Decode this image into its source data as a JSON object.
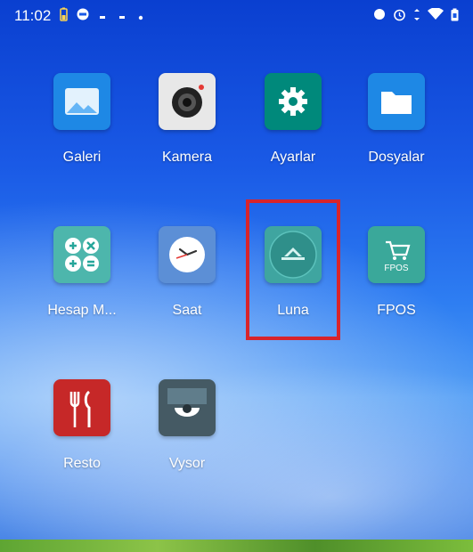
{
  "status_bar": {
    "time": "11:02",
    "left_icons": [
      "battery-icon",
      "notification-icon",
      "dot-icon",
      "dot-icon",
      "dot-icon"
    ],
    "right_icons": [
      "circle-icon",
      "alarm-icon",
      "data-arrows-icon",
      "wifi-icon",
      "battery-icon"
    ]
  },
  "apps": [
    {
      "label": "Galeri",
      "icon": "gallery-icon",
      "color": "#1e88e5"
    },
    {
      "label": "Kamera",
      "icon": "camera-icon",
      "color": "#e8e8e8"
    },
    {
      "label": "Ayarlar",
      "icon": "settings-gear-icon",
      "color": "#00897b"
    },
    {
      "label": "Dosyalar",
      "icon": "folder-icon",
      "color": "#1e88e5"
    },
    {
      "label": "Hesap M...",
      "icon": "calculator-icon",
      "color": "#4db6ac"
    },
    {
      "label": "Saat",
      "icon": "clock-icon",
      "color": "#5c8fd6"
    },
    {
      "label": "Luna",
      "icon": "luna-logo-icon",
      "color": "#3fa5a0"
    },
    {
      "label": "FPOS",
      "icon": "fpos-cart-icon",
      "color": "#3aa89a"
    },
    {
      "label": "Resto",
      "icon": "restaurant-icon",
      "color": "#c62828"
    },
    {
      "label": "Vysor",
      "icon": "vysor-eye-icon",
      "color": "#455a64"
    }
  ],
  "highlight_color": "#d8242b"
}
